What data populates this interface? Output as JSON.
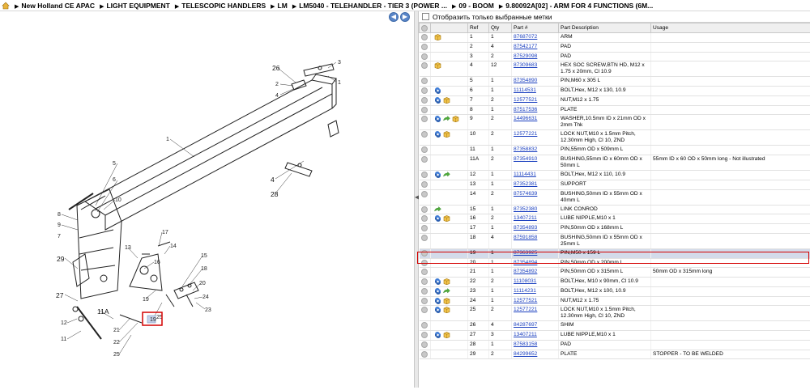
{
  "breadcrumb": [
    "New Holland CE APAC",
    "LIGHT EQUIPMENT",
    "TELESCOPIC HANDLERS",
    "LM",
    "LM5040 - TELEHANDLER - TIER 3 (POWER ...",
    "09 - BOOM",
    "9.80092A[02] - ARM FOR 4 FUNCTIONS (6M..."
  ],
  "filter": {
    "label": "Отобразить только выбранные метки"
  },
  "table": {
    "headers": [
      "",
      "",
      "Ref",
      "Qty",
      "Part #",
      "Part Description",
      "Usage"
    ],
    "rows": [
      {
        "icons": [
          "box"
        ],
        "ref": "1",
        "qty": "1",
        "part": "87687072",
        "desc": "ARM",
        "usage": ""
      },
      {
        "icons": [],
        "ref": "2",
        "qty": "4",
        "part": "87542177",
        "desc": "PAD",
        "usage": ""
      },
      {
        "icons": [],
        "ref": "3",
        "qty": "2",
        "part": "87529098",
        "desc": "PAD",
        "usage": ""
      },
      {
        "icons": [
          "box"
        ],
        "ref": "4",
        "qty": "12",
        "part": "87309683",
        "desc": "HEX SOC SCREW,BTN HD, M12 x 1.75 x 20mm, Cl 10.9",
        "usage": ""
      },
      {
        "icons": [],
        "ref": "5",
        "qty": "1",
        "part": "87354890",
        "desc": "PIN,M60 x 305 L",
        "usage": ""
      },
      {
        "icons": [
          "swap"
        ],
        "ref": "6",
        "qty": "1",
        "part": "11114531",
        "desc": "BOLT,Hex, M12 x 130, 10.9",
        "usage": ""
      },
      {
        "icons": [
          "swap",
          "box"
        ],
        "ref": "7",
        "qty": "2",
        "part": "12577521",
        "desc": "NUT,M12 x 1.75",
        "usage": ""
      },
      {
        "icons": [],
        "ref": "8",
        "qty": "1",
        "part": "87517536",
        "desc": "PLATE",
        "usage": ""
      },
      {
        "icons": [
          "swap",
          "arrow",
          "box"
        ],
        "ref": "9",
        "qty": "2",
        "part": "14496631",
        "desc": "WASHER,10.5mm ID x 21mm OD x 2mm Thk",
        "usage": ""
      },
      {
        "icons": [
          "swap",
          "box"
        ],
        "ref": "10",
        "qty": "2",
        "part": "12577221",
        "desc": "LOCK NUT,M10 x 1.5mm Pitch, 12.30mm High, Cl 10, ZND",
        "usage": ""
      },
      {
        "icons": [],
        "ref": "11",
        "qty": "1",
        "part": "87358832",
        "desc": "PIN,55mm OD x 509mm L",
        "usage": ""
      },
      {
        "icons": [],
        "ref": "11A",
        "qty": "2",
        "part": "87354910",
        "desc": "BUSHING,55mm ID x 60mm OD x 50mm L",
        "usage": "55mm ID x 60 OD x 50mm long - Not illustrated"
      },
      {
        "icons": [
          "swap",
          "arrow"
        ],
        "ref": "12",
        "qty": "1",
        "part": "11114431",
        "desc": "BOLT,Hex, M12 x 110, 10.9",
        "usage": ""
      },
      {
        "icons": [],
        "ref": "13",
        "qty": "1",
        "part": "87352381",
        "desc": "SUPPORT",
        "usage": ""
      },
      {
        "icons": [],
        "ref": "14",
        "qty": "2",
        "part": "87574639",
        "desc": "BUSHING,50mm ID x 55mm OD x 40mm L",
        "usage": ""
      },
      {
        "icons": [
          "arrow"
        ],
        "ref": "15",
        "qty": "1",
        "part": "87352380",
        "desc": "LINK CONROD",
        "usage": ""
      },
      {
        "icons": [
          "swap",
          "box"
        ],
        "ref": "16",
        "qty": "2",
        "part": "13407211",
        "desc": "LUBE NIPPLE,M10 x 1",
        "usage": ""
      },
      {
        "icons": [],
        "ref": "17",
        "qty": "1",
        "part": "87354893",
        "desc": "PIN,50mm OD x 168mm L",
        "usage": ""
      },
      {
        "icons": [],
        "ref": "18",
        "qty": "4",
        "part": "87591858",
        "desc": "BUSHING,50mm ID x 55mm OD x 25mm L",
        "usage": ""
      },
      {
        "icons": [],
        "ref": "19",
        "qty": "1",
        "part": "87363925",
        "desc": "PIN,M50 x 159 L",
        "usage": "",
        "selected": true
      },
      {
        "icons": [],
        "ref": "20",
        "qty": "1",
        "part": "87354894",
        "desc": "PIN,50mm OD x 200mm L",
        "usage": ""
      },
      {
        "icons": [],
        "ref": "21",
        "qty": "1",
        "part": "87354892",
        "desc": "PIN,50mm OD x 315mm L",
        "usage": "50mm OD x 315mm long"
      },
      {
        "icons": [
          "swap",
          "box"
        ],
        "ref": "22",
        "qty": "2",
        "part": "11108031",
        "desc": "BOLT,Hex, M10 x 90mm, Cl 10.9",
        "usage": ""
      },
      {
        "icons": [
          "swap",
          "arrow"
        ],
        "ref": "23",
        "qty": "1",
        "part": "11114231",
        "desc": "BOLT,Hex, M12 x 100, 10.9",
        "usage": ""
      },
      {
        "icons": [
          "swap",
          "box"
        ],
        "ref": "24",
        "qty": "1",
        "part": "12577521",
        "desc": "NUT,M12 x 1.75",
        "usage": ""
      },
      {
        "icons": [
          "swap",
          "box"
        ],
        "ref": "25",
        "qty": "2",
        "part": "12577221",
        "desc": "LOCK NUT,M10 x 1.5mm Pitch, 12.30mm High, Cl 10, ZND",
        "usage": ""
      },
      {
        "icons": [],
        "ref": "26",
        "qty": "4",
        "part": "84287697",
        "desc": "SHIM",
        "usage": ""
      },
      {
        "icons": [
          "swap",
          "box"
        ],
        "ref": "27",
        "qty": "3",
        "part": "13407211",
        "desc": "LUBE NIPPLE,M10 x 1",
        "usage": ""
      },
      {
        "icons": [],
        "ref": "28",
        "qty": "1",
        "part": "87583158",
        "desc": "PAD",
        "usage": ""
      },
      {
        "icons": [],
        "ref": "29",
        "qty": "2",
        "part": "84299652",
        "desc": "PLATE",
        "usage": "STOPPER - TO BE WELDED"
      }
    ]
  },
  "diagram": {
    "callouts": [
      "26",
      "2",
      "4",
      "3",
      "1",
      "4",
      "28",
      "5",
      "6",
      "8",
      "9",
      "10",
      "7",
      "29",
      "27",
      "11A",
      "13",
      "16",
      "17",
      "14",
      "15",
      "18",
      "19",
      "20",
      "21",
      "22",
      "23",
      "24",
      "25",
      "12",
      "11"
    ],
    "selected_ref": "19"
  },
  "colors": {
    "link": "#1a3fbf",
    "selected_row": "#d3dbea",
    "highlight": "#d40000",
    "nav_button": "#5a86c8"
  }
}
